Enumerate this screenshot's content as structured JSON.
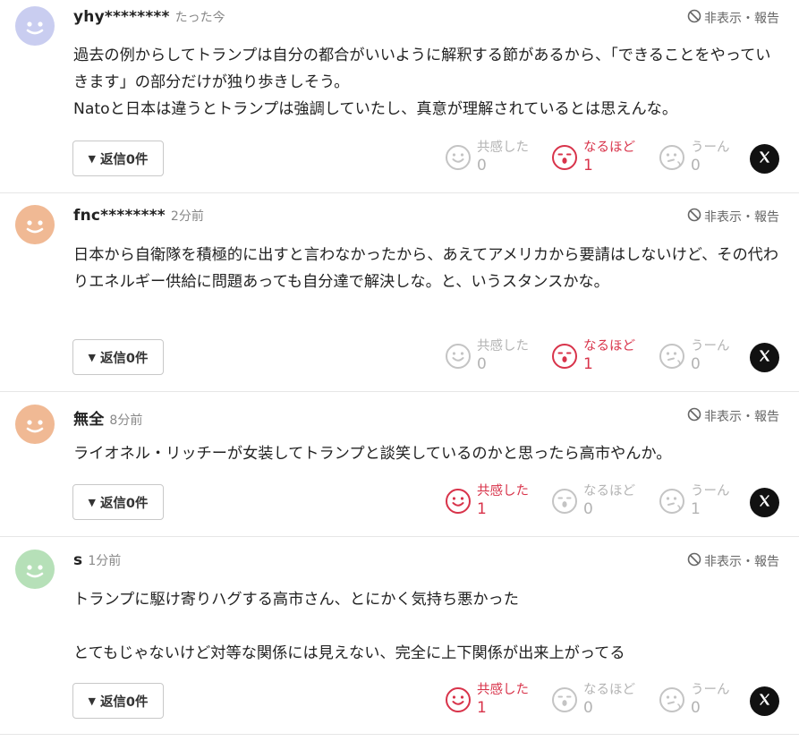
{
  "colors": {
    "active": "#d8334a",
    "inactive": "#c4c4c4",
    "x_bg": "#111111"
  },
  "comments": [
    {
      "user": "yhy********",
      "time": "たった今",
      "avatar_color": "#c9cdf0",
      "hide_report": "非表示・報告",
      "body": "過去の例からしてトランプは自分の都合がいいように解釈する節があるから、「できることをやっていきます」の部分だけが独り歩きしそう。\nNatoと日本は違うとトランプは強調していたし、真意が理解されているとは思えんな。",
      "reply": "返信0件",
      "reactions": [
        {
          "label": "共感した",
          "count": "0",
          "icon": "smile-icon",
          "active": false
        },
        {
          "label": "なるほど",
          "count": "1",
          "icon": "surprise-icon",
          "active": true
        },
        {
          "label": "うーん",
          "count": "0",
          "icon": "hmm-icon",
          "active": false
        }
      ],
      "share": "x-icon"
    },
    {
      "user": "fnc********",
      "time": "2分前",
      "avatar_color": "#f0b994",
      "hide_report": "非表示・報告",
      "body": "日本から自衛隊を積極的に出すと言わなかったから、あえてアメリカから要請はしないけど、その代わりエネルギー供給に問題あっても自分達で解決しな。と、いうスタンスかな。",
      "reply": "返信0件",
      "reactions": [
        {
          "label": "共感した",
          "count": "0",
          "icon": "smile-icon",
          "active": false
        },
        {
          "label": "なるほど",
          "count": "1",
          "icon": "surprise-icon",
          "active": true
        },
        {
          "label": "うーん",
          "count": "0",
          "icon": "hmm-icon",
          "active": false
        }
      ],
      "share": "x-icon"
    },
    {
      "user": "無全",
      "time": "8分前",
      "avatar_color": "#f0b994",
      "hide_report": "非表示・報告",
      "body": "ライオネル・リッチーが女装してトランプと談笑しているのかと思ったら高市やんか。",
      "reply": "返信0件",
      "reactions": [
        {
          "label": "共感した",
          "count": "1",
          "icon": "smile-icon",
          "active": true
        },
        {
          "label": "なるほど",
          "count": "0",
          "icon": "surprise-icon",
          "active": false
        },
        {
          "label": "うーん",
          "count": "1",
          "icon": "hmm-icon",
          "active": false
        }
      ],
      "share": "x-icon"
    },
    {
      "user": "s",
      "time": "1分前",
      "avatar_color": "#b6e0b8",
      "hide_report": "非表示・報告",
      "body": "トランプに駆け寄りハグする高市さん、とにかく気持ち悪かった\n\nとてもじゃないけど対等な関係には見えない、完全に上下関係が出来上がってる",
      "reply": "返信0件",
      "reactions": [
        {
          "label": "共感した",
          "count": "1",
          "icon": "smile-icon",
          "active": true
        },
        {
          "label": "なるほど",
          "count": "0",
          "icon": "surprise-icon",
          "active": false
        },
        {
          "label": "うーん",
          "count": "0",
          "icon": "hmm-icon",
          "active": false
        }
      ],
      "share": "x-icon"
    }
  ]
}
